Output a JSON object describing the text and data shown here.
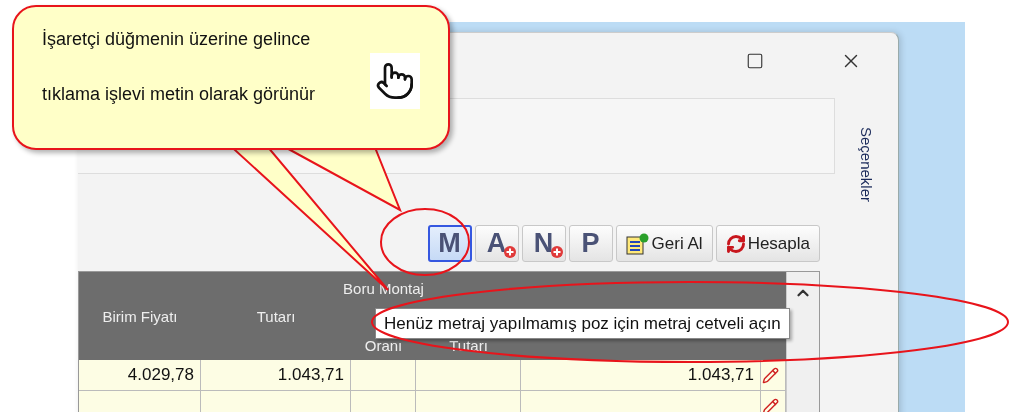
{
  "callout": {
    "lines": [
      "İşaretçi düğmenin  üzerine  gelince",
      "tıklama işlevi metin olarak görünür"
    ]
  },
  "window": {
    "side_tab": "Seçenekler"
  },
  "toolbar": {
    "buttons": [
      {
        "kind": "letter",
        "label": "M",
        "selected": true,
        "badge": false
      },
      {
        "kind": "letter",
        "label": "A",
        "selected": false,
        "badge": true
      },
      {
        "kind": "letter",
        "label": "N",
        "selected": false,
        "badge": true
      },
      {
        "kind": "letter",
        "label": "P",
        "selected": false,
        "badge": false
      },
      {
        "kind": "undo",
        "label": "Geri Al",
        "selected": false
      },
      {
        "kind": "calculate",
        "label": "Hesapla",
        "selected": false
      }
    ]
  },
  "table": {
    "columns": [
      {
        "lines": [
          "Birim Fiyatı"
        ]
      },
      {
        "lines": [
          "Tutarı"
        ]
      },
      {
        "lines": [
          "Boru Montaj",
          "Oranı"
        ]
      },
      {
        "lines": [
          "Tutarı"
        ]
      }
    ],
    "rows": [
      {
        "cells": [
          "4.029,78",
          "1.043,71",
          null,
          null,
          "1.043,71"
        ]
      }
    ]
  },
  "tooltip": {
    "text": "Henüz metraj yapılmamış poz için metraj cetveli açın"
  }
}
